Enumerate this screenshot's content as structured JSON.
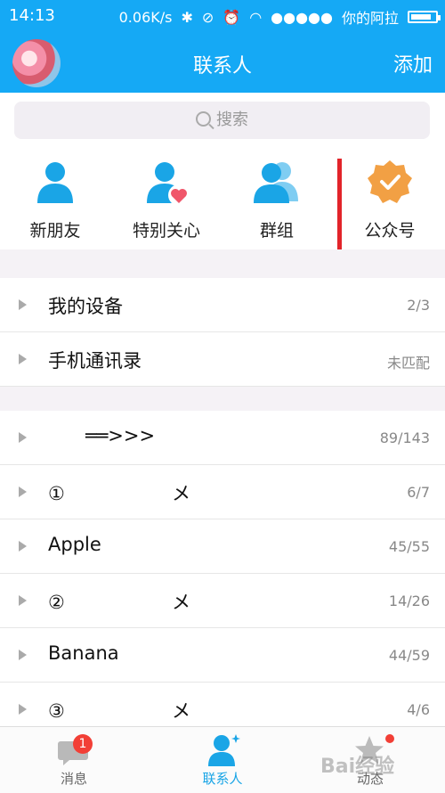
{
  "status_bar": {
    "time": "14:13",
    "speed": "0.06K/s",
    "signal": "●●●●●",
    "carrier": "你的阿拉",
    "battery_level": 0.85
  },
  "header": {
    "title": "联系人",
    "add_label": "添加"
  },
  "search": {
    "placeholder": "搜索"
  },
  "quick_actions": [
    {
      "label": "新朋友",
      "icon": "person-icon"
    },
    {
      "label": "特别关心",
      "icon": "person-heart-icon"
    },
    {
      "label": "群组",
      "icon": "group-icon"
    },
    {
      "label": "公众号",
      "icon": "verified-badge-icon"
    }
  ],
  "top_groups": [
    {
      "label": "我的设备",
      "count": "2/3"
    },
    {
      "label": "手机通讯录",
      "count": "未匹配"
    }
  ],
  "groups": [
    {
      "label": "══>>>",
      "count": "89/143"
    },
    {
      "label": "①                  メ",
      "count": "6/7"
    },
    {
      "label": "Apple",
      "count": "45/55"
    },
    {
      "label": "②                  メ",
      "count": "14/26"
    },
    {
      "label": "Banana",
      "count": "44/59"
    },
    {
      "label": "③                  メ",
      "count": "4/6"
    }
  ],
  "tabs": [
    {
      "label": "消息",
      "badge": "1"
    },
    {
      "label": "联系人"
    },
    {
      "label": "动态"
    }
  ],
  "watermark": "Bai经验",
  "colors": {
    "accent": "#15a9f5",
    "badge": "#f23f36",
    "annotation": "#e2242a",
    "verified": "#f2a044"
  }
}
